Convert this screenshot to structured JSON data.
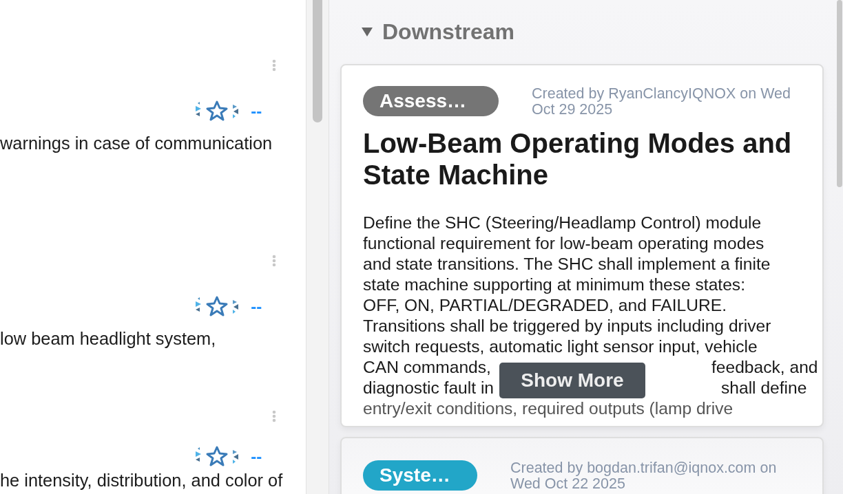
{
  "left_panel": {
    "rows": [
      {
        "link": "--",
        "text": "warnings in case of communication"
      },
      {
        "link": "--",
        "text": "low beam headlight system,"
      },
      {
        "link": "--",
        "text": "he intensity, distribution, and color of"
      }
    ]
  },
  "downstream": {
    "title": "Downstream",
    "expanded": true,
    "cards": [
      {
        "badge": "Assess…",
        "color": "#757575",
        "meta": "Created by RyanClancyIQNOX on Wed Oct 29 2025",
        "title": "Low-Beam Operating Modes and State Machine",
        "description_lines": [
          {
            "left": "Define the SHC (Steering/Headlamp Control) module"
          },
          {
            "left": "functional requirement for low-beam operating modes"
          },
          {
            "left": "and state transitions. The SHC shall implement a finite"
          },
          {
            "left": "state machine supporting at minimum these states:"
          },
          {
            "left": "OFF, ON, PARTIAL/DEGRADED, and FAILURE."
          },
          {
            "left": "Transitions shall be triggered by inputs including driver"
          },
          {
            "left": "switch requests, automatic light sensor input, vehicle"
          },
          {
            "left": "CAN commands,",
            "right": "feedback, and"
          },
          {
            "left": "diagnostic fault in",
            "right": "shall define"
          },
          {
            "left": "entry/exit conditions, required outputs (lamp drive"
          }
        ],
        "show_more": "Show More"
      },
      {
        "badge": "Syste…",
        "color": "#22a6c8",
        "meta": "Created by bogdan.trifan@iqnox.com on Wed Oct 22 2025"
      }
    ]
  }
}
